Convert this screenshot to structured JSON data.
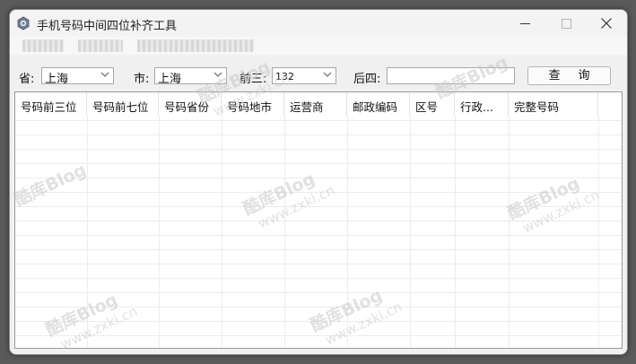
{
  "window": {
    "title": "手机号码中间四位补齐工具",
    "icon": "gear-app-icon"
  },
  "controls": {
    "province_label": "省:",
    "province_value": "上海",
    "city_label": "市:",
    "city_value": "上海",
    "prefix_label": "前三:",
    "prefix_value": "132",
    "suffix_label": "后四:",
    "suffix_value": "",
    "query_label": "查询"
  },
  "table": {
    "columns": [
      "号码前三位",
      "号码前七位",
      "号码省份",
      "号码地市",
      "运营商",
      "邮政编码",
      "区号",
      "行政...",
      "完整号码"
    ]
  },
  "watermark": {
    "brand": "酷库Blog",
    "url": "www.zxki.cn"
  }
}
